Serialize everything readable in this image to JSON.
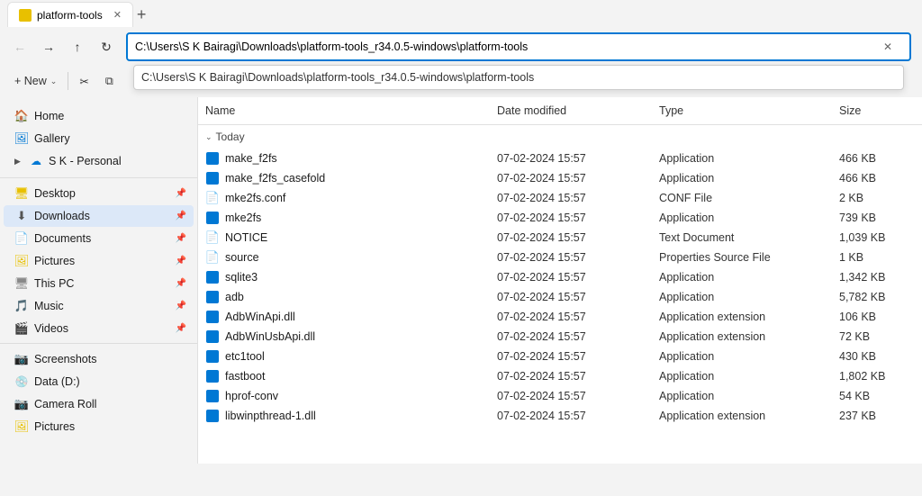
{
  "titleBar": {
    "tab": {
      "label": "platform-tools",
      "closeLabel": "✕"
    },
    "newTabLabel": "+"
  },
  "toolbar": {
    "backLabel": "←",
    "forwardLabel": "→",
    "upLabel": "↑",
    "refreshLabel": "↻",
    "addressValue": "C:\\Users\\S K Bairagi\\Downloads\\platform-tools_r34.0.5-windows\\platform-tools",
    "suggestion": "C:\\Users\\S K Bairagi\\Downloads\\platform-tools_r34.0.5-windows\\platform-tools"
  },
  "quickToolbar": {
    "newLabel": "+ New",
    "newChevron": "⌄",
    "cutLabel": "✂",
    "copyLabel": "⧉"
  },
  "sidebar": {
    "topItems": [
      {
        "id": "home",
        "icon": "🏠",
        "iconClass": "icon-home",
        "label": "Home"
      },
      {
        "id": "gallery",
        "icon": "🖼",
        "iconClass": "icon-gallery",
        "label": "Gallery"
      }
    ],
    "skGroup": {
      "arrowLabel": "▶",
      "icon": "☁",
      "iconClass": "icon-cloud",
      "label": "S K - Personal"
    },
    "pinnedItems": [
      {
        "id": "desktop",
        "icon": "🖥",
        "iconClass": "icon-desktop",
        "label": "Desktop",
        "pin": "📌"
      },
      {
        "id": "downloads",
        "icon": "⬇",
        "iconClass": "icon-downloads",
        "label": "Downloads",
        "pin": "📌",
        "active": true
      },
      {
        "id": "documents",
        "icon": "📄",
        "iconClass": "icon-docs",
        "label": "Documents",
        "pin": "📌"
      },
      {
        "id": "pictures",
        "icon": "🖼",
        "iconClass": "icon-pictures",
        "label": "Pictures",
        "pin": "📌"
      },
      {
        "id": "thispc",
        "icon": "🖥",
        "iconClass": "icon-pc",
        "label": "This PC",
        "pin": "📌"
      },
      {
        "id": "music",
        "icon": "🎵",
        "iconClass": "icon-music",
        "label": "Music",
        "pin": "📌"
      },
      {
        "id": "videos",
        "icon": "🎬",
        "iconClass": "icon-videos",
        "label": "Videos",
        "pin": "📌"
      }
    ],
    "bottomItems": [
      {
        "id": "screenshots",
        "icon": "📷",
        "iconClass": "icon-screenshots",
        "label": "Screenshots"
      },
      {
        "id": "datad",
        "icon": "💿",
        "iconClass": "icon-drive",
        "label": "Data (D:)"
      },
      {
        "id": "cameraroll",
        "icon": "📷",
        "iconClass": "icon-camera",
        "label": "Camera Roll"
      },
      {
        "id": "pictures2",
        "icon": "🖼",
        "iconClass": "icon-pictures",
        "label": "Pictures"
      }
    ]
  },
  "fileList": {
    "columns": [
      {
        "id": "name",
        "label": "Name"
      },
      {
        "id": "datemodified",
        "label": "Date modified"
      },
      {
        "id": "type",
        "label": "Type"
      },
      {
        "id": "size",
        "label": "Size"
      }
    ],
    "groups": [
      {
        "label": "Today",
        "files": [
          {
            "name": "make_f2fs",
            "iconType": "app",
            "date": "07-02-2024 15:57",
            "type": "Application",
            "size": "466 KB"
          },
          {
            "name": "make_f2fs_casefold",
            "iconType": "app",
            "date": "07-02-2024 15:57",
            "type": "Application",
            "size": "466 KB"
          },
          {
            "name": "mke2fs.conf",
            "iconType": "conf",
            "date": "07-02-2024 15:57",
            "type": "CONF File",
            "size": "2 KB"
          },
          {
            "name": "mke2fs",
            "iconType": "app",
            "date": "07-02-2024 15:57",
            "type": "Application",
            "size": "739 KB"
          },
          {
            "name": "NOTICE",
            "iconType": "text",
            "date": "07-02-2024 15:57",
            "type": "Text Document",
            "size": "1,039 KB"
          },
          {
            "name": "source",
            "iconType": "conf",
            "date": "07-02-2024 15:57",
            "type": "Properties Source File",
            "size": "1 KB"
          },
          {
            "name": "sqlite3",
            "iconType": "app",
            "date": "07-02-2024 15:57",
            "type": "Application",
            "size": "1,342 KB"
          },
          {
            "name": "adb",
            "iconType": "app",
            "date": "07-02-2024 15:57",
            "type": "Application",
            "size": "5,782 KB"
          },
          {
            "name": "AdbWinApi.dll",
            "iconType": "dll",
            "date": "07-02-2024 15:57",
            "type": "Application extension",
            "size": "106 KB"
          },
          {
            "name": "AdbWinUsbApi.dll",
            "iconType": "dll",
            "date": "07-02-2024 15:57",
            "type": "Application extension",
            "size": "72 KB"
          },
          {
            "name": "etc1tool",
            "iconType": "app",
            "date": "07-02-2024 15:57",
            "type": "Application",
            "size": "430 KB"
          },
          {
            "name": "fastboot",
            "iconType": "app",
            "date": "07-02-2024 15:57",
            "type": "Application",
            "size": "1,802 KB"
          },
          {
            "name": "hprof-conv",
            "iconType": "app",
            "date": "07-02-2024 15:57",
            "type": "Application",
            "size": "54 KB"
          },
          {
            "name": "libwinpthread-1.dll",
            "iconType": "dll",
            "date": "07-02-2024 15:57",
            "type": "Application extension",
            "size": "237 KB"
          }
        ]
      }
    ]
  }
}
